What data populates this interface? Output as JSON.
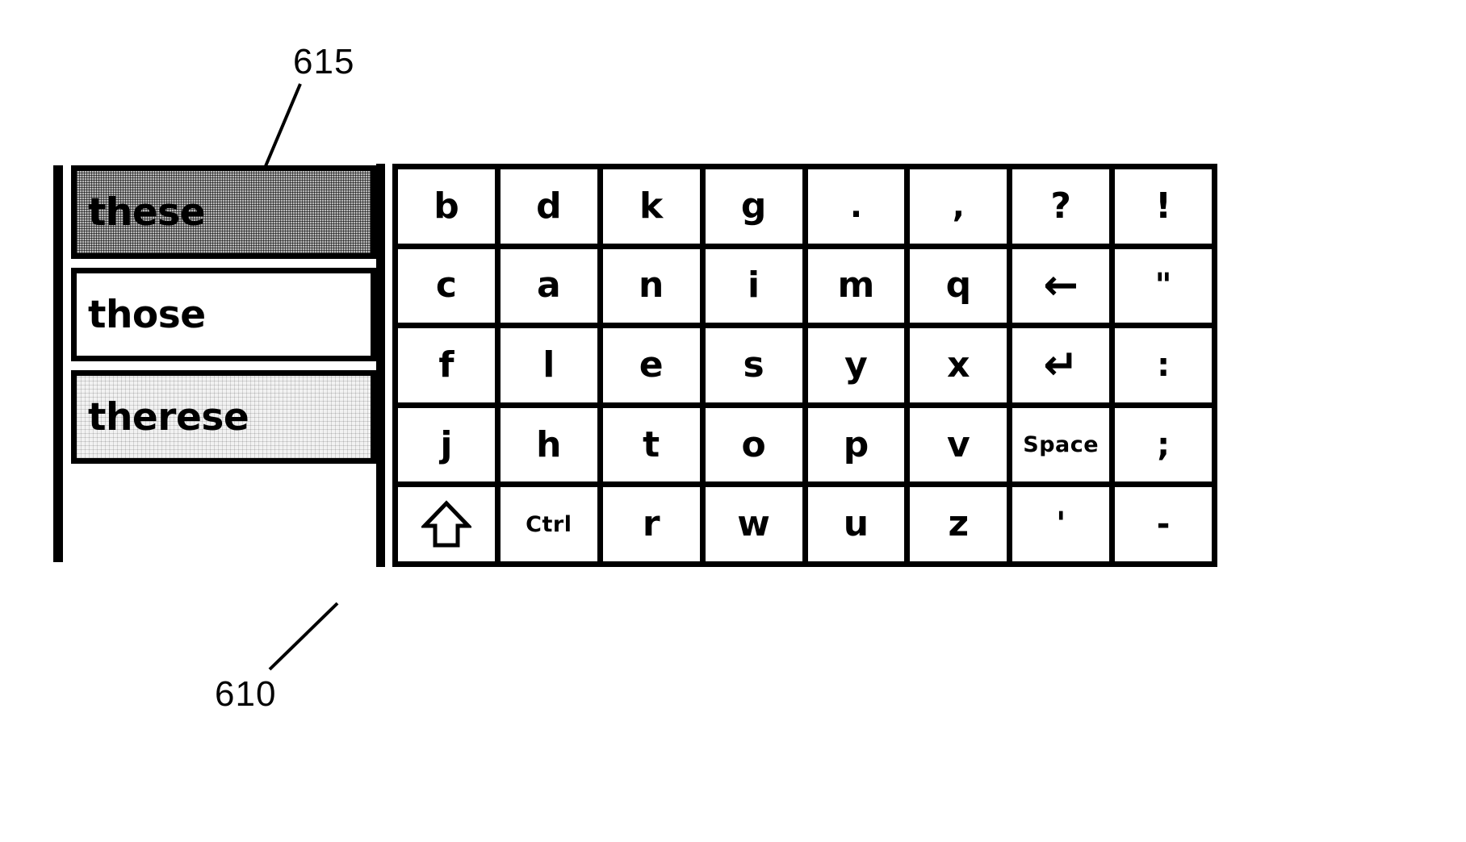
{
  "figure": {
    "ref_panel": "610",
    "ref_selected": "615"
  },
  "suggestion_panel": {
    "name": "word-suggestion-list",
    "items": [
      {
        "text": "these",
        "state": "selected"
      },
      {
        "text": "those",
        "state": "normal"
      },
      {
        "text": "therese",
        "state": "faint"
      }
    ]
  },
  "keyboard": {
    "rows": [
      [
        {
          "label": "b",
          "icon": "key-b"
        },
        {
          "label": "d",
          "icon": "key-d"
        },
        {
          "label": "k",
          "icon": "key-k"
        },
        {
          "label": "g",
          "icon": "key-g"
        },
        {
          "label": ".",
          "icon": "key-period"
        },
        {
          "label": ",",
          "icon": "key-comma"
        },
        {
          "label": "?",
          "icon": "key-question"
        },
        {
          "label": "!",
          "icon": "key-exclamation"
        }
      ],
      [
        {
          "label": "c",
          "icon": "key-c"
        },
        {
          "label": "a",
          "icon": "key-a"
        },
        {
          "label": "n",
          "icon": "key-n"
        },
        {
          "label": "i",
          "icon": "key-i"
        },
        {
          "label": "m",
          "icon": "key-m"
        },
        {
          "label": "q",
          "icon": "key-q"
        },
        {
          "label": "←",
          "icon": "backspace-arrow-icon",
          "style": "glyph-arrow"
        },
        {
          "label": "\"",
          "icon": "key-quote",
          "style": "small-punct"
        }
      ],
      [
        {
          "label": "f",
          "icon": "key-f"
        },
        {
          "label": "l",
          "icon": "key-l"
        },
        {
          "label": "e",
          "icon": "key-e"
        },
        {
          "label": "s",
          "icon": "key-s"
        },
        {
          "label": "y",
          "icon": "key-y"
        },
        {
          "label": "x",
          "icon": "key-x"
        },
        {
          "label": "↵",
          "icon": "enter-return-icon",
          "style": "glyph-enter"
        },
        {
          "label": ":",
          "icon": "key-colon",
          "style": "small-punct"
        }
      ],
      [
        {
          "label": "j",
          "icon": "key-j"
        },
        {
          "label": "h",
          "icon": "key-h"
        },
        {
          "label": "t",
          "icon": "key-t"
        },
        {
          "label": "o",
          "icon": "key-o"
        },
        {
          "label": "p",
          "icon": "key-p"
        },
        {
          "label": "v",
          "icon": "key-v"
        },
        {
          "label": "Space",
          "icon": "space-bar-key",
          "style": "word"
        },
        {
          "label": ";",
          "icon": "key-semicolon",
          "style": "small-punct"
        }
      ],
      [
        {
          "label": "",
          "icon": "shift-up-arrow-icon",
          "style": "shift"
        },
        {
          "label": "Ctrl",
          "icon": "control-key",
          "style": "word"
        },
        {
          "label": "r",
          "icon": "key-r"
        },
        {
          "label": "w",
          "icon": "key-w"
        },
        {
          "label": "u",
          "icon": "key-u"
        },
        {
          "label": "z",
          "icon": "key-z"
        },
        {
          "label": "'",
          "icon": "key-apostrophe",
          "style": "small-punct"
        },
        {
          "label": "-",
          "icon": "key-hyphen",
          "style": "small-punct"
        }
      ]
    ]
  }
}
